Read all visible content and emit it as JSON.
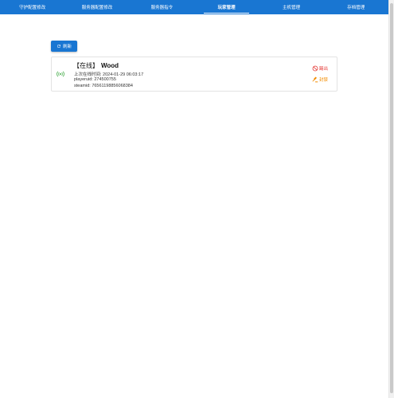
{
  "nav": {
    "tabs": [
      {
        "label": "守护配置修改"
      },
      {
        "label": "服务器配置修改"
      },
      {
        "label": "服务器指令"
      },
      {
        "label": "玩家管理"
      },
      {
        "label": "主机管理"
      },
      {
        "label": "存档管理"
      }
    ],
    "active_index": 3
  },
  "toolbar": {
    "refresh_label": "刷新"
  },
  "players": [
    {
      "status_label": "【在线】",
      "name": "Wood",
      "last_online": "上次在线时间: 2024-01-29 06:03:17",
      "playeruid": "playeruid: 274500755",
      "steamid": "steamid: 76561198856068384",
      "kick_label": "踢出",
      "ban_label": "封禁"
    }
  ],
  "colors": {
    "primary": "#1976d2",
    "online": "#4caf50",
    "kick": "#e53935",
    "ban": "#f28c00"
  }
}
